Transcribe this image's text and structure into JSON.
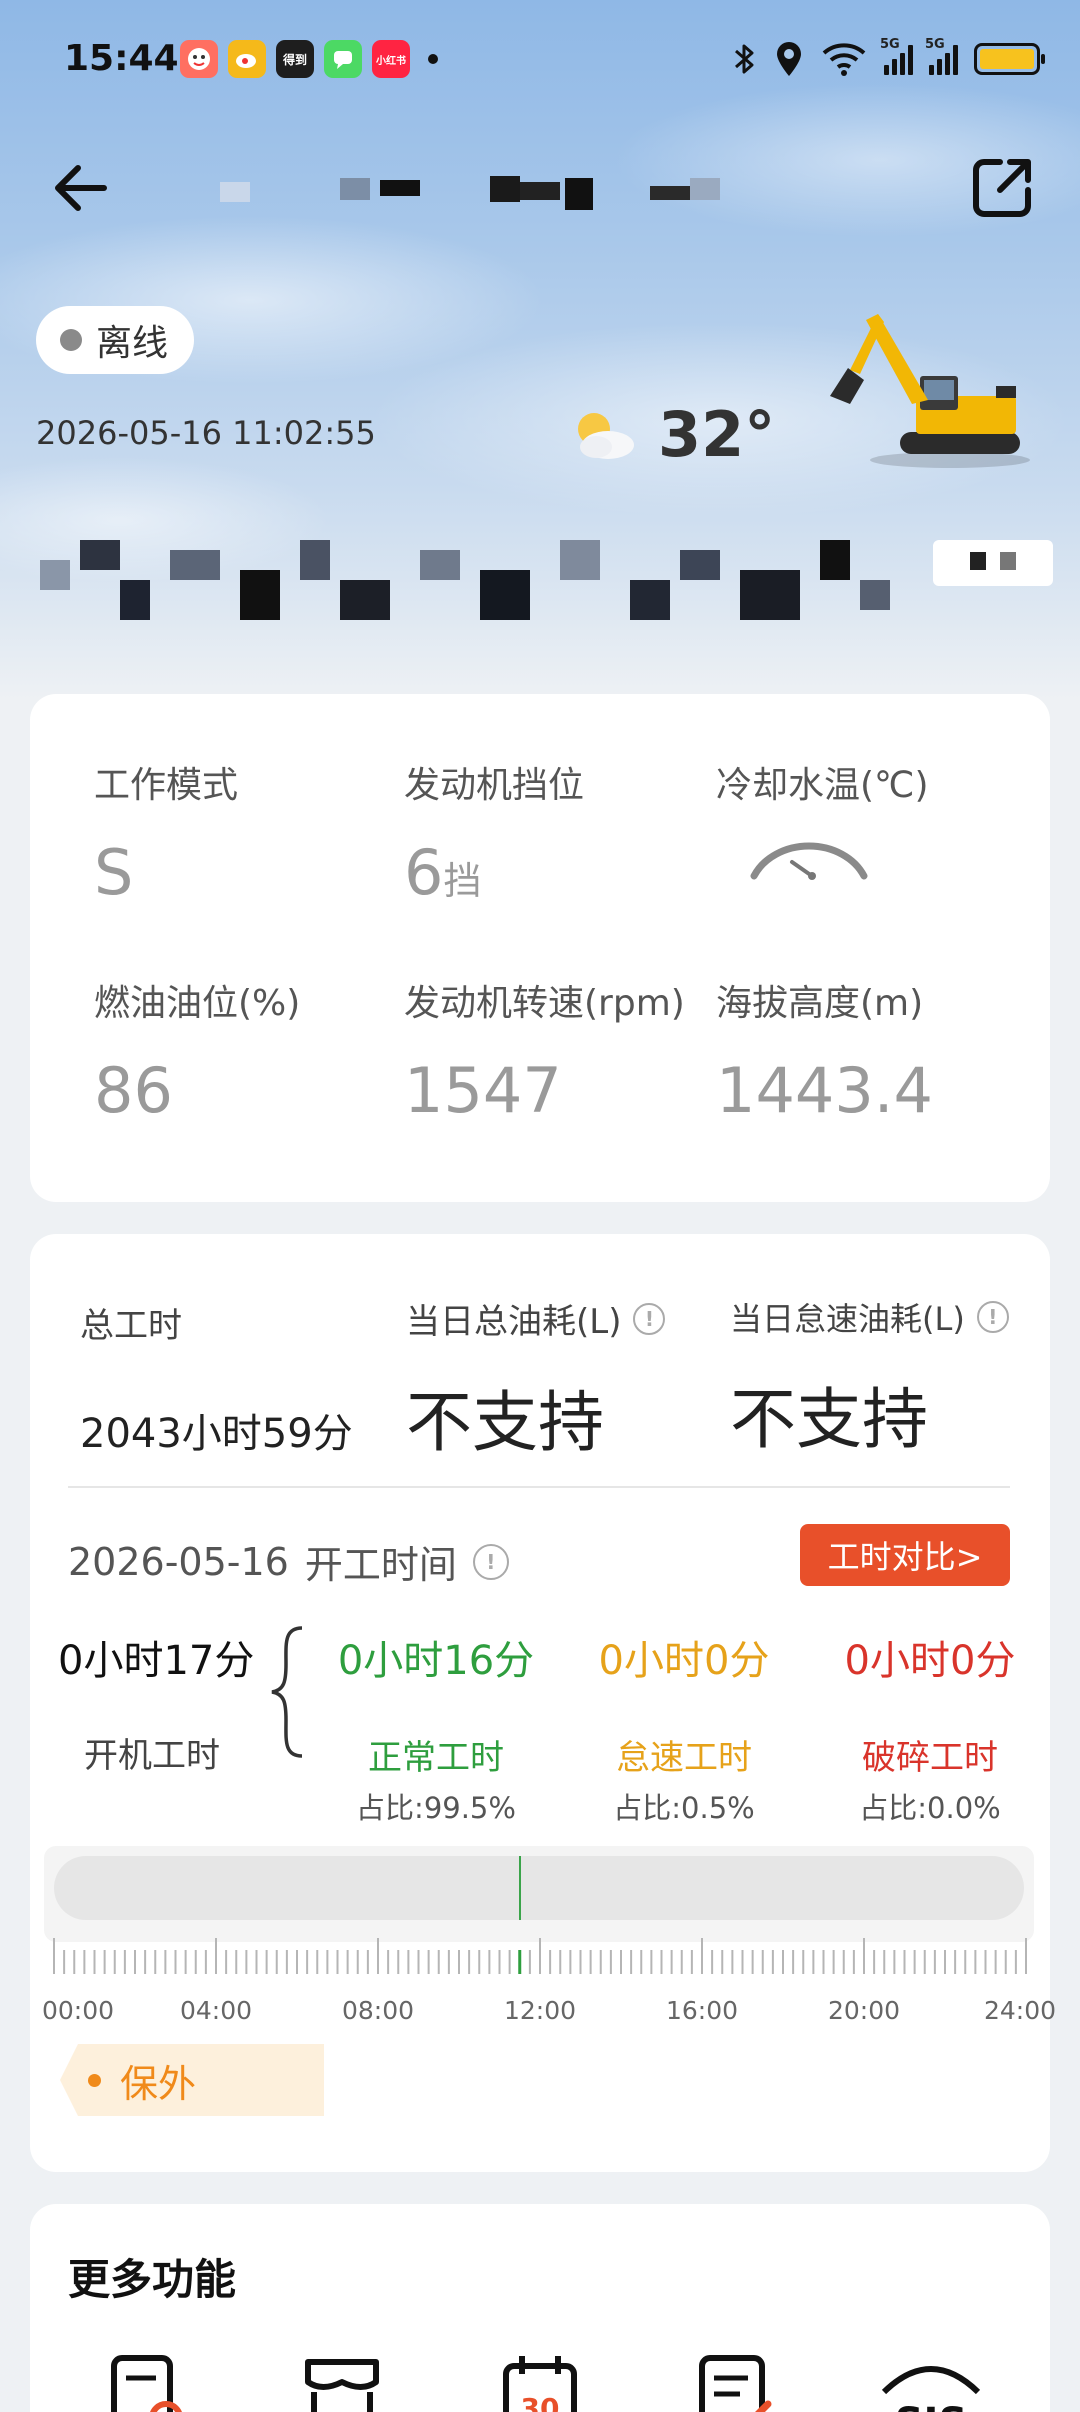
{
  "status_bar": {
    "time": "15:44",
    "apps": [
      {
        "name": "app-icon-1",
        "text": "",
        "color": "#ff6f61"
      },
      {
        "name": "weibo-icon",
        "text": "",
        "color": "#f5b91a"
      },
      {
        "name": "news-icon",
        "text": "得到",
        "color": "#1e1e1e"
      },
      {
        "name": "messages-icon",
        "text": "",
        "color": "#4cd964"
      },
      {
        "name": "xiaohongshu-icon",
        "text": "小红书",
        "color": "#ff2442"
      }
    ],
    "network_labels": [
      "5G",
      "5G"
    ],
    "battery_color": "#f7c21e"
  },
  "header": {
    "back_icon": "arrow-left-icon",
    "share_icon": "share-icon",
    "status_label": "离线",
    "timestamp": "2026-05-16 11:02:55",
    "temperature": "32°",
    "weather_icon": "partly-cloudy-icon"
  },
  "realtime": {
    "work_mode_label": "工作模式",
    "work_mode_value": "S",
    "gear_label": "发动机挡位",
    "gear_value": "6",
    "gear_unit": "挡",
    "coolant_label": "冷却水温(℃)",
    "fuel_label": "燃油油位(%)",
    "fuel_value": "86",
    "rpm_label": "发动机转速(rpm)",
    "rpm_value": "1547",
    "altitude_label": "海拔高度(m)",
    "altitude_value": "1443.4"
  },
  "hours": {
    "total_hours_label": "总工时",
    "total_hours_value": "2043小时59分",
    "daily_fuel_label": "当日总油耗(L)",
    "daily_fuel_value": "不支持",
    "idle_fuel_label": "当日怠速油耗(L)",
    "idle_fuel_value": "不支持",
    "date": "2026-05-16",
    "start_time_label": "开工时间",
    "compare_button": "工时对比>",
    "on_hours_value": "0小时17分",
    "on_hours_label": "开机工时",
    "normal_value": "0小时16分",
    "normal_label": "正常工时",
    "normal_ratio": "占比:99.5%",
    "idle_value": "0小时0分",
    "idle_label": "怠速工时",
    "idle_ratio": "占比:0.5%",
    "break_value": "0小时0分",
    "break_label": "破碎工时",
    "break_ratio": "占比:0.0%",
    "colors": {
      "normal": "#2e9e3e",
      "idle": "#e6a21a",
      "break": "#d9342b"
    },
    "timeline_marker_hour": 11.5,
    "timeline_ticks": [
      "00:00",
      "04:00",
      "08:00",
      "12:00",
      "16:00",
      "20:00",
      "24:00"
    ],
    "warranty_label": "保外"
  },
  "more": {
    "title": "更多功能",
    "icons": [
      "report-icon",
      "store-icon",
      "calendar-icon",
      "document-edit-icon",
      "sis-icon"
    ]
  }
}
